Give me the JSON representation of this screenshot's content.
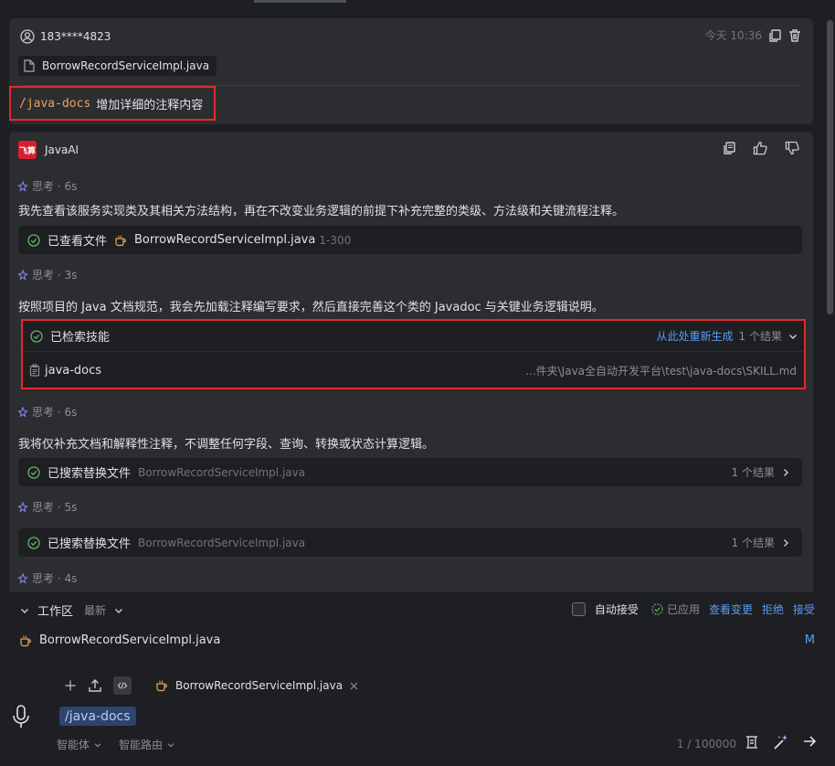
{
  "user": {
    "id": "183****4823",
    "time": "今天 10:36"
  },
  "attachment": {
    "file": "BorrowRecordServiceImpl.java"
  },
  "command": {
    "code": "/java-docs",
    "text": "增加详细的注释内容"
  },
  "assistant": {
    "name": "JavaAI",
    "logo_text": "飞算",
    "thinks": [
      "思考 · 6s",
      "思考 · 3s",
      "思考 · 6s",
      "思考 · 5s",
      "思考 · 4s"
    ],
    "para1": "我先查看该服务实现类及其相关方法结构，再在不改变业务逻辑的前提下补充完整的类级、方法级和关键流程注释。",
    "tool1": {
      "label": "已查看文件",
      "file": "BorrowRecordServiceImpl.java",
      "range": "1-300"
    },
    "para2": "按照项目的 Java 文档规范，我会先加载注释编写要求，然后直接完善这个类的 Javadoc 与关键业务逻辑说明。",
    "skill": {
      "label": "已检索技能",
      "regen": "从此处重新生成",
      "count": "1 个结果",
      "name": "java-docs",
      "path": "...件夹\\Java全自动开发平台\\test\\java-docs\\SKILL.md"
    },
    "para3": "我将仅补充文档和解释性注释，不调整任何字段、查询、转换或状态计算逻辑。",
    "tool2": {
      "label": "已搜索替换文件",
      "file": "BorrowRecordServiceImpl.java",
      "count": "1 个结果"
    },
    "tool3": {
      "label": "已搜索替换文件",
      "file": "BorrowRecordServiceImpl.java",
      "count": "1 个结果"
    }
  },
  "workspace": {
    "title": "工作区",
    "sort": "最新",
    "auto_accept": "自动接受",
    "applied": "已应用",
    "view_changes": "查看变更",
    "reject": "拒绝",
    "accept": "接受",
    "file": "BorrowRecordServiceImpl.java",
    "file_status": "M"
  },
  "composer": {
    "context_file": "BorrowRecordServiceImpl.java",
    "tag": "/java-docs",
    "agent": "智能体",
    "routing": "智能路由",
    "counter": "1 / 100000"
  }
}
